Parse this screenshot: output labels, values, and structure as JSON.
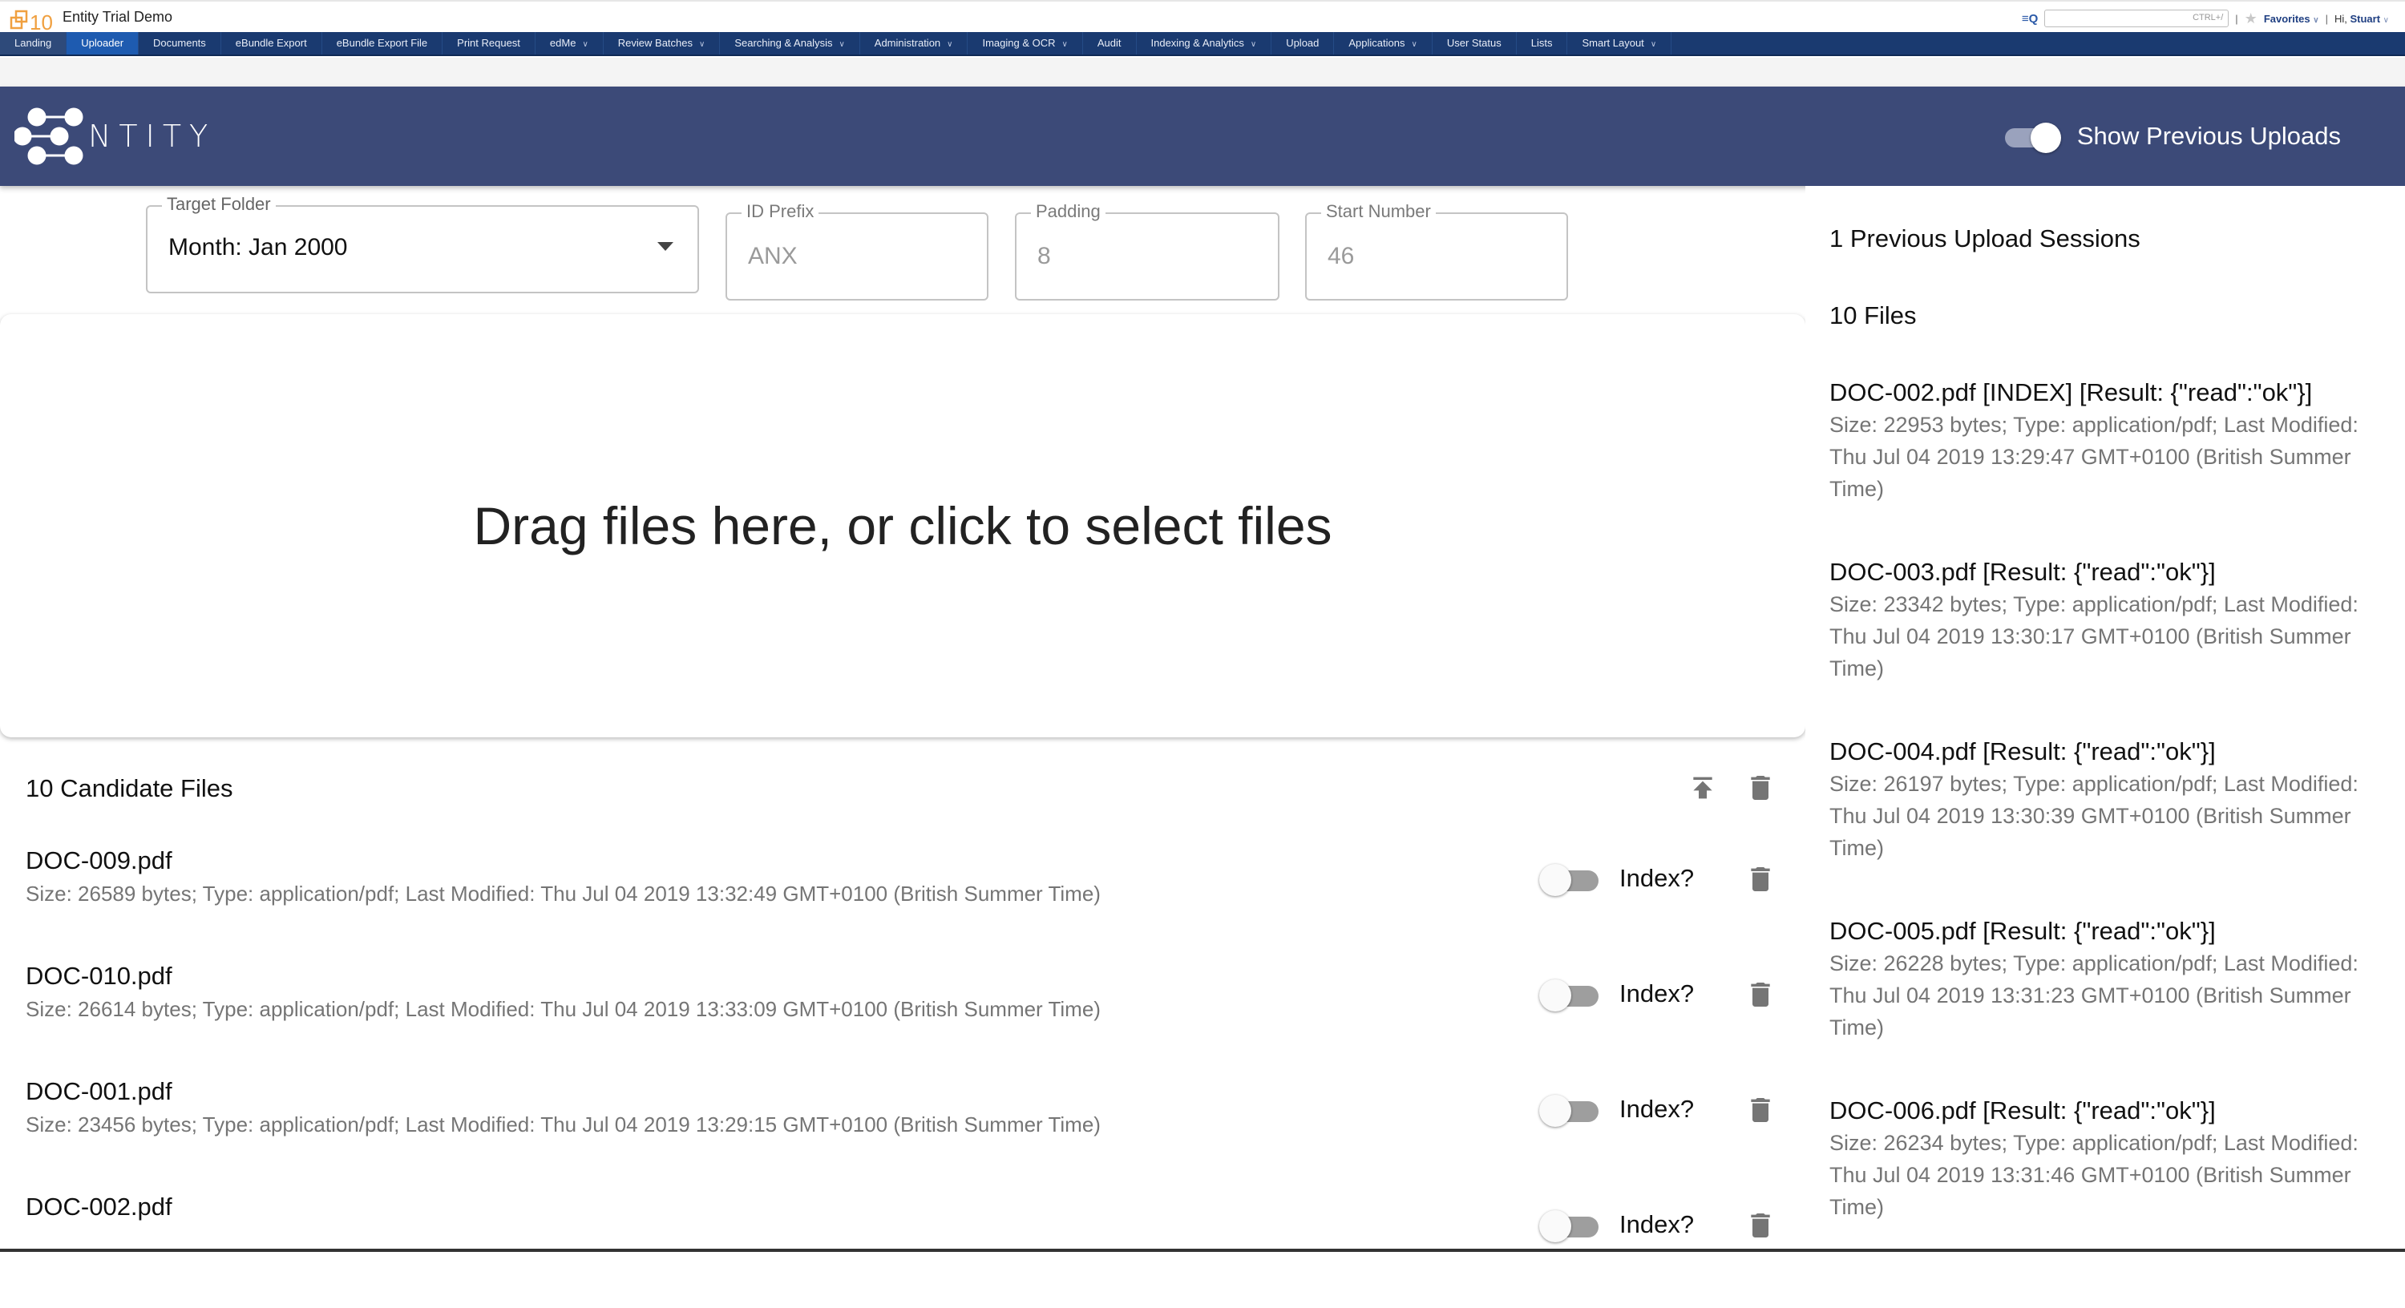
{
  "topbar": {
    "logo_text": "10",
    "title": "Entity Trial Demo",
    "quick_search_icon": "quick-search-icon",
    "quick_search_hint": "CTRL+/",
    "separator": "|",
    "favorites_label": "Favorites",
    "greeting_prefix": "Hi,",
    "user_name": "Stuart"
  },
  "nav": {
    "items": [
      {
        "label": "Landing",
        "dropdown": false
      },
      {
        "label": "Uploader",
        "dropdown": false,
        "active": true
      },
      {
        "label": "Documents",
        "dropdown": false
      },
      {
        "label": "eBundle Export",
        "dropdown": false
      },
      {
        "label": "eBundle Export File",
        "dropdown": false
      },
      {
        "label": "Print Request",
        "dropdown": false
      },
      {
        "label": "edMe",
        "dropdown": true
      },
      {
        "label": "Review Batches",
        "dropdown": true
      },
      {
        "label": "Searching & Analysis",
        "dropdown": true
      },
      {
        "label": "Administration",
        "dropdown": true
      },
      {
        "label": "Imaging & OCR",
        "dropdown": true
      },
      {
        "label": "Audit",
        "dropdown": false
      },
      {
        "label": "Indexing & Analytics",
        "dropdown": true
      },
      {
        "label": "Upload",
        "dropdown": false
      },
      {
        "label": "Applications",
        "dropdown": true
      },
      {
        "label": "User Status",
        "dropdown": false
      },
      {
        "label": "Lists",
        "dropdown": false
      },
      {
        "label": "Smart Layout",
        "dropdown": true
      }
    ],
    "dropdown_glyph": "⌄"
  },
  "app_header": {
    "brand_word": "NTITY",
    "show_previous_label": "Show Previous Uploads",
    "show_previous_on": true
  },
  "form": {
    "target_folder": {
      "label": "Target Folder",
      "value": "Month: Jan 2000"
    },
    "id_prefix": {
      "label": "ID Prefix",
      "value": "ANX"
    },
    "padding": {
      "label": "Padding",
      "value": "8"
    },
    "start_number": {
      "label": "Start Number",
      "value": "46"
    }
  },
  "dropzone": {
    "text": "Drag files here, or click to select files"
  },
  "candidates": {
    "title": "10 Candidate Files",
    "index_label": "Index?",
    "files": [
      {
        "name": "DOC-009.pdf",
        "meta": "Size: 26589 bytes; Type: application/pdf; Last Modified: Thu Jul 04 2019 13:32:49 GMT+0100 (British Summer Time)",
        "index": false
      },
      {
        "name": "DOC-010.pdf",
        "meta": "Size: 26614 bytes; Type: application/pdf; Last Modified: Thu Jul 04 2019 13:33:09 GMT+0100 (British Summer Time)",
        "index": false
      },
      {
        "name": "DOC-001.pdf",
        "meta": "Size: 23456 bytes; Type: application/pdf; Last Modified: Thu Jul 04 2019 13:29:15 GMT+0100 (British Summer Time)",
        "index": false
      },
      {
        "name": "DOC-002.pdf",
        "meta": "",
        "index": false
      }
    ]
  },
  "previous": {
    "sessions_label": "1 Previous Upload Sessions",
    "files_label": "10 Files",
    "files": [
      {
        "name": "DOC-002.pdf [INDEX] [Result: {\"read\":\"ok\"}]",
        "meta": "Size: 22953 bytes; Type: application/pdf; Last Modified: Thu Jul 04 2019 13:29:47 GMT+0100 (British Summer Time)"
      },
      {
        "name": "DOC-003.pdf [Result: {\"read\":\"ok\"}]",
        "meta": "Size: 23342 bytes; Type: application/pdf; Last Modified: Thu Jul 04 2019 13:30:17 GMT+0100 (British Summer Time)"
      },
      {
        "name": "DOC-004.pdf [Result: {\"read\":\"ok\"}]",
        "meta": "Size: 26197 bytes; Type: application/pdf; Last Modified: Thu Jul 04 2019 13:30:39 GMT+0100 (British Summer Time)"
      },
      {
        "name": "DOC-005.pdf [Result: {\"read\":\"ok\"}]",
        "meta": "Size: 26228 bytes; Type: application/pdf; Last Modified: Thu Jul 04 2019 13:31:23 GMT+0100 (British Summer Time)"
      },
      {
        "name": "DOC-006.pdf [Result: {\"read\":\"ok\"}]",
        "meta": "Size: 26234 bytes; Type: application/pdf; Last Modified: Thu Jul 04 2019 13:31:46 GMT+0100 (British Summer Time)"
      }
    ]
  },
  "colors": {
    "nav_bg": "#1a3a70",
    "nav_active": "#1e5bb0",
    "header_bg": "#3c4a78",
    "brand_orange": "#f0a040",
    "icon_gray": "#757575"
  }
}
